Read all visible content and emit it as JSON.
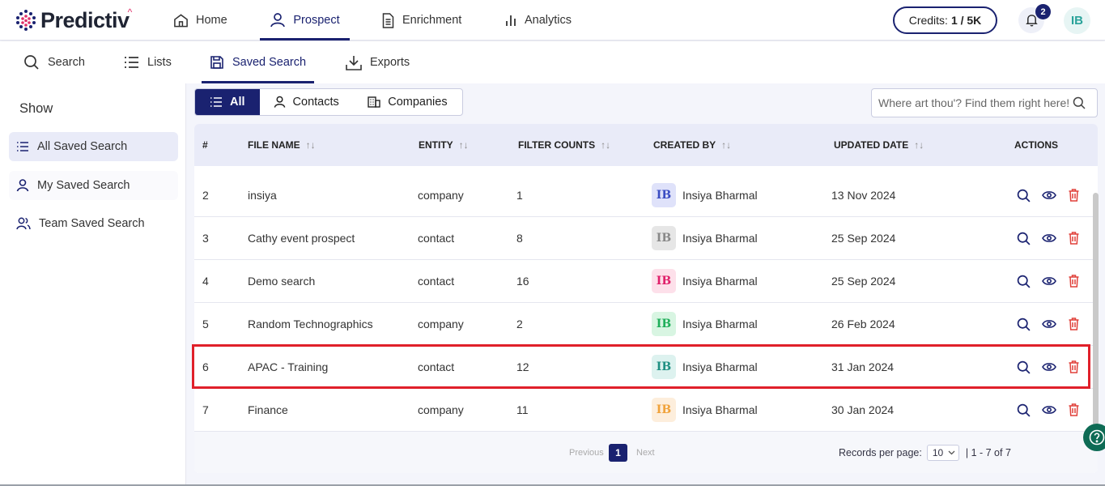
{
  "app": {
    "logo_text": "Predictiv"
  },
  "topnav": {
    "items": [
      {
        "label": "Home",
        "icon": "home-icon"
      },
      {
        "label": "Prospect",
        "icon": "user-icon"
      },
      {
        "label": "Enrichment",
        "icon": "document-icon"
      },
      {
        "label": "Analytics",
        "icon": "bar-chart-icon"
      }
    ],
    "active": "Prospect",
    "credits_label": "Credits:",
    "credits_value": "1 / 5K",
    "notification_count": "2",
    "avatar_initials": "IB"
  },
  "subnav": {
    "items": [
      {
        "label": "Search",
        "icon": "search-icon"
      },
      {
        "label": "Lists",
        "icon": "list-icon"
      },
      {
        "label": "Saved Search",
        "icon": "save-icon"
      },
      {
        "label": "Exports",
        "icon": "download-icon"
      }
    ],
    "active": "Saved Search"
  },
  "sidebar": {
    "title": "Show",
    "items": [
      {
        "label": "All Saved Search",
        "icon": "list-icon"
      },
      {
        "label": "My Saved Search",
        "icon": "user-icon"
      },
      {
        "label": "Team Saved Search",
        "icon": "users-icon"
      }
    ],
    "active": "All Saved Search"
  },
  "filters": {
    "tabs": [
      {
        "label": "All",
        "icon": "list-icon"
      },
      {
        "label": "Contacts",
        "icon": "user-icon"
      },
      {
        "label": "Companies",
        "icon": "building-icon"
      }
    ],
    "active": "All",
    "search_placeholder": "Where art thou'? Find them right here!"
  },
  "table": {
    "columns": [
      "#",
      "FILE NAME",
      "ENTITY",
      "FILTER COUNTS",
      "CREATED BY",
      "UPDATED DATE",
      "ACTIONS"
    ],
    "sort_glyph": "↑↓",
    "rows": [
      {
        "num": "2",
        "file_name": "insiya",
        "entity": "company",
        "filter_counts": "1",
        "avatar": "IB",
        "created_by": "Insiya Bharmal",
        "updated": "13 Nov 2024",
        "avatar_color": "#3a4cc2",
        "avatar_bg": "#dfe2fa"
      },
      {
        "num": "3",
        "file_name": "Cathy event prospect",
        "entity": "contact",
        "filter_counts": "8",
        "avatar": "IB",
        "created_by": "Insiya Bharmal",
        "updated": "25 Sep 2024",
        "avatar_color": "#888888",
        "avatar_bg": "#e6e6e6"
      },
      {
        "num": "4",
        "file_name": "Demo search",
        "entity": "contact",
        "filter_counts": "16",
        "avatar": "IB",
        "created_by": "Insiya Bharmal",
        "updated": "25 Sep 2024",
        "avatar_color": "#e0206a",
        "avatar_bg": "#fde0ea"
      },
      {
        "num": "5",
        "file_name": "Random Technographics",
        "entity": "company",
        "filter_counts": "2",
        "avatar": "IB",
        "created_by": "Insiya Bharmal",
        "updated": "26 Feb 2024",
        "avatar_color": "#1fae5a",
        "avatar_bg": "#d8f5e2"
      },
      {
        "num": "6",
        "file_name": "APAC - Training",
        "entity": "contact",
        "filter_counts": "12",
        "avatar": "IB",
        "created_by": "Insiya Bharmal",
        "updated": "31 Jan 2024",
        "avatar_color": "#1f8f82",
        "avatar_bg": "#ddf2ef"
      },
      {
        "num": "7",
        "file_name": "Finance",
        "entity": "company",
        "filter_counts": "11",
        "avatar": "IB",
        "created_by": "Insiya Bharmal",
        "updated": "30 Jan 2024",
        "avatar_color": "#f0a23a",
        "avatar_bg": "#fdeedc"
      }
    ],
    "highlighted_row": "6"
  },
  "pagination": {
    "previous_label": "Previous",
    "current_page": "1",
    "next_label": "Next",
    "records_per_page_label": "Records per page:",
    "records_per_page_value": "10",
    "range_label": "|  1 - 7 of 7"
  },
  "colors": {
    "brand": "#1a2270",
    "delete": "#e0403a",
    "highlight": "#e0202a",
    "help": "#0e6b55"
  }
}
